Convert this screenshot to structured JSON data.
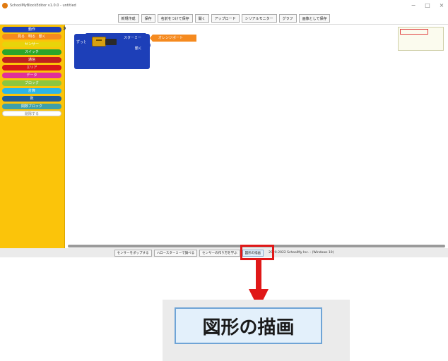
{
  "window": {
    "title": "SchoolMyBlockEditor v1.0.0 - untitled",
    "controls": [
      "−",
      "□",
      "×"
    ]
  },
  "toolbar": {
    "buttons": [
      "新規作成",
      "保存",
      "名前をつけて保存",
      "開く",
      "アップロード",
      "シリアルモニター",
      "グラフ",
      "画像として保存"
    ]
  },
  "palette": {
    "categories": [
      {
        "label": "動作",
        "color": "#1d3fb8"
      },
      {
        "label": "見る　明る　動く",
        "color": "#f58a1f"
      },
      {
        "label": "センサー",
        "color": "#e8d40a"
      },
      {
        "label": "スイッチ",
        "color": "#2aa52a"
      },
      {
        "label": "通信",
        "color": "#c0201e"
      },
      {
        "label": "エリア",
        "color": "#d81818"
      },
      {
        "label": "データ",
        "color": "#e0309a"
      },
      {
        "label": "ブロック",
        "color": "#8cc63f"
      },
      {
        "label": "計算",
        "color": "#2bb5e8"
      },
      {
        "label": "数",
        "color": "#1f5c9a"
      },
      {
        "label": "関数ブロック",
        "color": "#3fa0a8"
      },
      {
        "label": "削除する",
        "color": "#ffffff"
      }
    ]
  },
  "workspace": {
    "forever_label": "ずっと",
    "starmie_label": "スターミー",
    "move_label": "動く",
    "chip_label": "オレンジボート"
  },
  "bottombar": {
    "buttons": [
      "センサーをポップする",
      "ハロースターミーで調べる",
      "センサーの作り方を学ぶ",
      "図形の描画"
    ],
    "copyright": "2020-2022 SchoolMy Inc. - (Windows 10)"
  },
  "callout": {
    "label": "図形の描画"
  }
}
